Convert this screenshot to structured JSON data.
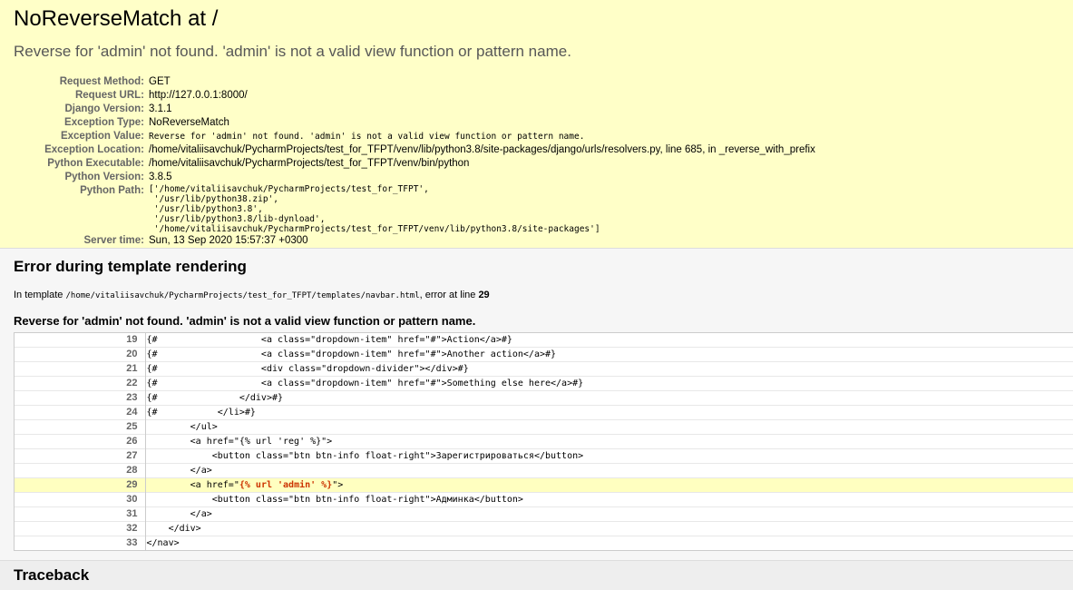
{
  "summary": {
    "title": "NoReverseMatch at /",
    "exception_value": "Reverse for 'admin' not found. 'admin' is not a valid view function or pattern name.",
    "meta": {
      "request_method_label": "Request Method:",
      "request_method": "GET",
      "request_url_label": "Request URL:",
      "request_url": "http://127.0.0.1:8000/",
      "django_version_label": "Django Version:",
      "django_version": "3.1.1",
      "exception_type_label": "Exception Type:",
      "exception_type": "NoReverseMatch",
      "exception_value_label": "Exception Value:",
      "exception_value": "Reverse for 'admin' not found. 'admin' is not a valid view function or pattern name.",
      "exception_location_label": "Exception Location:",
      "exception_location": "/home/vitaliisavchuk/PycharmProjects/test_for_TFPT/venv/lib/python3.8/site-packages/django/urls/resolvers.py, line 685, in _reverse_with_prefix",
      "python_executable_label": "Python Executable:",
      "python_executable": "/home/vitaliisavchuk/PycharmProjects/test_for_TFPT/venv/bin/python",
      "python_version_label": "Python Version:",
      "python_version": "3.8.5",
      "python_path_label": "Python Path:",
      "python_path": "['/home/vitaliisavchuk/PycharmProjects/test_for_TFPT',\n '/usr/lib/python38.zip',\n '/usr/lib/python3.8',\n '/usr/lib/python3.8/lib-dynload',\n '/home/vitaliisavchuk/PycharmProjects/test_for_TFPT/venv/lib/python3.8/site-packages']",
      "server_time_label": "Server time:",
      "server_time": "Sun, 13 Sep 2020 15:57:37 +0300"
    }
  },
  "template": {
    "heading": "Error during template rendering",
    "info_prefix": "In template ",
    "template_path": "/home/vitaliisavchuk/PycharmProjects/test_for_TFPT/templates/navbar.html",
    "info_middle": ", error at line ",
    "error_line": "29",
    "message": "Reverse for 'admin' not found. 'admin' is not a valid view function or pattern name.",
    "lines": [
      {
        "num": "19",
        "code": "{#                   <a class=\"dropdown-item\" href=\"#\">Action</a>#}"
      },
      {
        "num": "20",
        "code": "{#                   <a class=\"dropdown-item\" href=\"#\">Another action</a>#}"
      },
      {
        "num": "21",
        "code": "{#                   <div class=\"dropdown-divider\"></div>#}"
      },
      {
        "num": "22",
        "code": "{#                   <a class=\"dropdown-item\" href=\"#\">Something else here</a>#}"
      },
      {
        "num": "23",
        "code": "{#               </div>#}"
      },
      {
        "num": "24",
        "code": "{#           </li>#}"
      },
      {
        "num": "25",
        "code": "        </ul>"
      },
      {
        "num": "26",
        "code": "        <a href=\"{% url 'reg' %}\">"
      },
      {
        "num": "27",
        "code": "            <button class=\"btn btn-info float-right\">Зарегистрироваться</button>"
      },
      {
        "num": "28",
        "code": "        </a>"
      },
      {
        "num": "29",
        "code_before": "        <a href=\"",
        "code_specific": "{% url 'admin' %}",
        "code_after": "\">"
      },
      {
        "num": "30",
        "code": "            <button class=\"btn btn-info float-right\">Админка</button>"
      },
      {
        "num": "31",
        "code": "        </a>"
      },
      {
        "num": "32",
        "code": "    </div>"
      },
      {
        "num": "33",
        "code": "</nav>"
      }
    ]
  },
  "traceback": {
    "heading": "Traceback"
  }
}
